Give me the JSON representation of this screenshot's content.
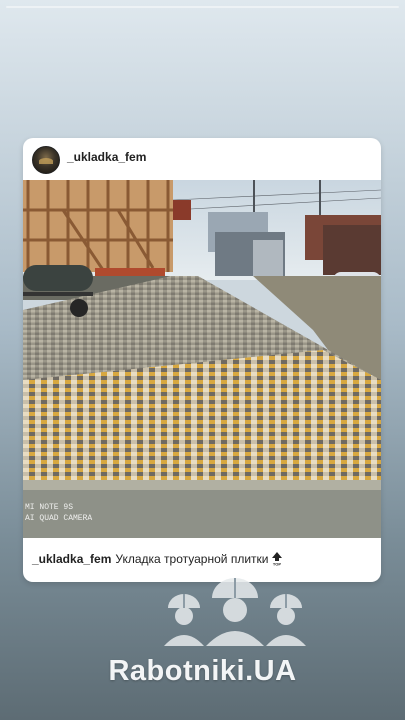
{
  "post": {
    "username": "_ukladka_fem",
    "caption_user": "_ukladka_fem",
    "caption_text": "Укладка тротуарной плитки",
    "caption_icon": "top-arrow-icon",
    "photo": {
      "watermark_line1": "MI NOTE 9S",
      "watermark_line2": "AI QUAD CAMERA"
    }
  },
  "brand": {
    "name": "Rabotniki.UA",
    "logo_icon": "workers-helmets-icon"
  },
  "colors": {
    "card_background": "#ffffff",
    "page_gradient_top": "#dfe8ee",
    "page_gradient_bottom": "#5d6c74",
    "brand_text": "#f3f5f6"
  }
}
